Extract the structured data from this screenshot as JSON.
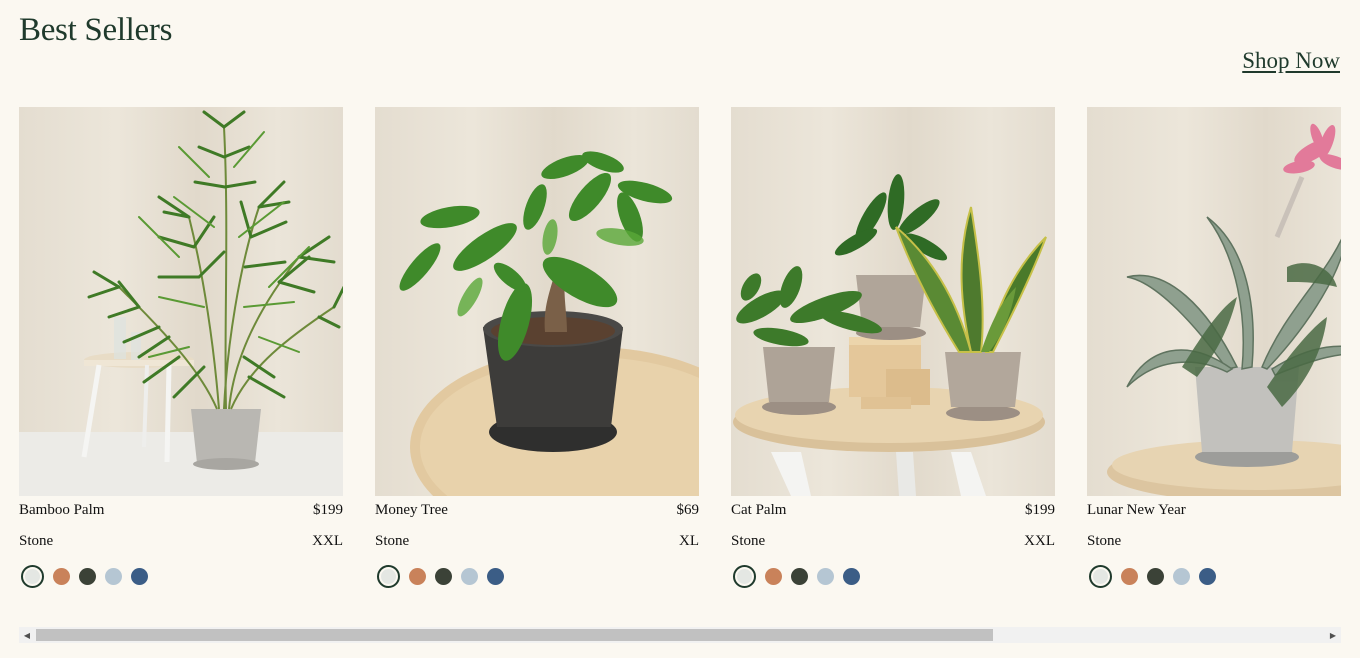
{
  "header": {
    "title": "Best Sellers",
    "shop_now": "Shop Now"
  },
  "products": [
    {
      "name": "Bamboo Palm",
      "price": "$199",
      "color": "Stone",
      "size": "XXL",
      "image": "bamboo-palm-photo"
    },
    {
      "name": "Money Tree",
      "price": "$69",
      "color": "Stone",
      "size": "XL",
      "image": "money-tree-photo"
    },
    {
      "name": "Cat Palm",
      "price": "$199",
      "color": "Stone",
      "size": "XXL",
      "image": "cat-palm-photo"
    },
    {
      "name": "Lunar New Year",
      "price": "",
      "color": "Stone",
      "size": "",
      "image": "lunar-new-year-photo"
    }
  ],
  "swatch_colors": [
    "#e4e7e3",
    "#c9825a",
    "#3b4237",
    "#b5c6d3",
    "#3b5d86"
  ],
  "selected_swatch_index": 0,
  "scrollbar": {
    "left_arrow": "◀",
    "right_arrow": "▶",
    "position_fraction": 0.0,
    "visible_fraction": 0.75
  }
}
